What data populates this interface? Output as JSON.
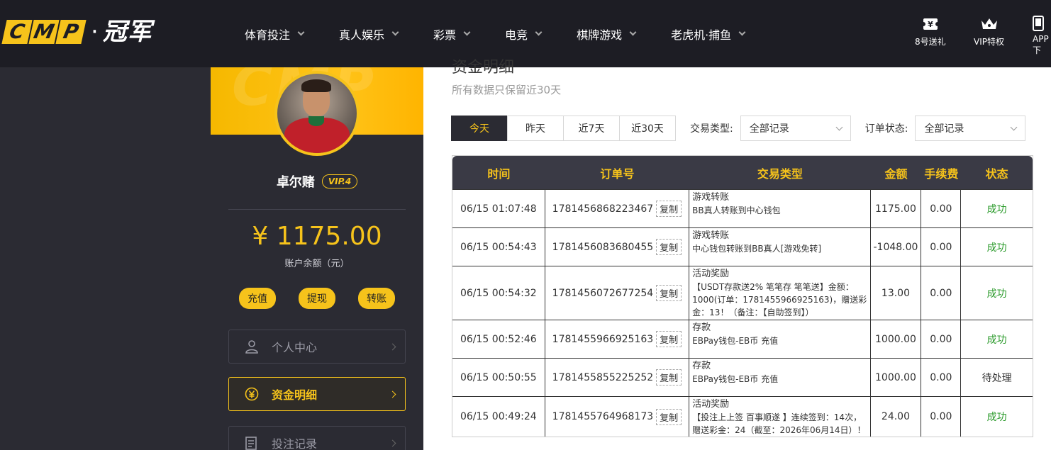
{
  "header": {
    "logo_letters": [
      "C",
      "M",
      "P"
    ],
    "logo_text": "冠军",
    "nav": [
      {
        "label": "体育投注"
      },
      {
        "label": "真人娱乐"
      },
      {
        "label": "彩票"
      },
      {
        "label": "电竞"
      },
      {
        "label": "棋牌游戏"
      },
      {
        "label": "老虎机·捕鱼"
      }
    ],
    "right_items": [
      {
        "label": "8号送礼",
        "icon": "gift-ticket-icon"
      },
      {
        "label": "VIP特权",
        "icon": "crown-icon"
      },
      {
        "label": "APP下",
        "icon": "phone-icon"
      }
    ]
  },
  "sidebar": {
    "username": "卓尔赌",
    "vip": "VIP.4",
    "balance": "¥ 1175.00",
    "balance_label": "账户余额（元）",
    "actions": [
      "充值",
      "提现",
      "转账"
    ],
    "menu": [
      {
        "label": "个人中心",
        "icon": "user-icon",
        "active": false
      },
      {
        "label": "资金明细",
        "icon": "currency-yen-icon",
        "active": true
      },
      {
        "label": "投注记录",
        "icon": "list-icon",
        "active": false
      }
    ]
  },
  "main": {
    "title": "资金明细",
    "subtitle": "所有数据只保留近30天",
    "date_tabs": [
      "今天",
      "昨天",
      "近7天",
      "近30天"
    ],
    "active_tab": 0,
    "type_label": "交易类型:",
    "type_value": "全部记录",
    "status_label": "订单状态:",
    "status_value": "全部记录",
    "columns": [
      "时间",
      "订单号",
      "交易类型",
      "金额",
      "手续费",
      "状态"
    ],
    "copy_label": "复制",
    "rows": [
      {
        "time": "06/15 01:07:48",
        "order": "1781456868223467",
        "type": "游戏转账",
        "detail": "BB真人转账到中心钱包",
        "amount": "1175.00",
        "fee": "0.00",
        "status": "成功",
        "ok": true
      },
      {
        "time": "06/15 00:54:43",
        "order": "1781456083680455",
        "type": "游戏转账",
        "detail": "中心钱包转账到BB真人[游戏免转]",
        "amount": "-1048.00",
        "fee": "0.00",
        "status": "成功",
        "ok": true
      },
      {
        "time": "06/15 00:54:32",
        "order": "1781456072677254",
        "type": "活动奖励",
        "detail": "【USDT存款送2% 笔笔存 笔笔送】金额：1000(订单：1781455966925163)，赠送彩金：13！（备注：【自助签到】）",
        "amount": "13.00",
        "fee": "0.00",
        "status": "成功",
        "ok": true
      },
      {
        "time": "06/15 00:52:46",
        "order": "1781455966925163",
        "type": "存款",
        "detail": "EBPay钱包-EB币 充值",
        "amount": "1000.00",
        "fee": "0.00",
        "status": "成功",
        "ok": true
      },
      {
        "time": "06/15 00:50:55",
        "order": "1781455855225252",
        "type": "存款",
        "detail": "EBPay钱包-EB币 充值",
        "amount": "1000.00",
        "fee": "0.00",
        "status": "待处理",
        "ok": false
      },
      {
        "time": "06/15 00:49:24",
        "order": "1781455764968173",
        "type": "活动奖励",
        "detail": "【投注上上签 百事顺遂 】连续签到：14次，赠送彩金：24（截至：2026年06月14日）！",
        "amount": "24.00",
        "fee": "0.00",
        "status": "成功",
        "ok": true
      }
    ]
  },
  "colors": {
    "accent": "#f6c31b",
    "dark": "#2b2b33",
    "success": "#2a9a2a"
  }
}
